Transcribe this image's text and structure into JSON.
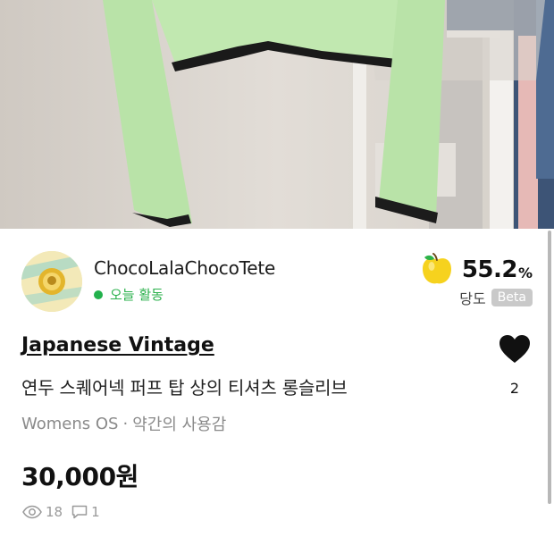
{
  "product": {
    "image_icon": "product-photo",
    "brand": "Japanese Vintage",
    "title": "연두 스퀘어넥 퍼프 탑 상의 티셔츠 롱슬리브",
    "category": "Womens OS",
    "separator": "·",
    "condition": "약간의 사용감",
    "price": "30,000원",
    "like_count": "2",
    "views": "18",
    "comments": "1"
  },
  "seller": {
    "name": "ChocoLalaChocoTete",
    "activity": "오늘 활동",
    "activity_color": "#22b14c"
  },
  "sweetness": {
    "value": "55.2",
    "unit": "%",
    "label": "당도",
    "badge": "Beta",
    "fruit_icon": "yellow-apple-icon"
  },
  "colors": {
    "brand_text": "#111111",
    "muted": "#8a8a8a",
    "badge_bg": "#c9c9c9"
  }
}
